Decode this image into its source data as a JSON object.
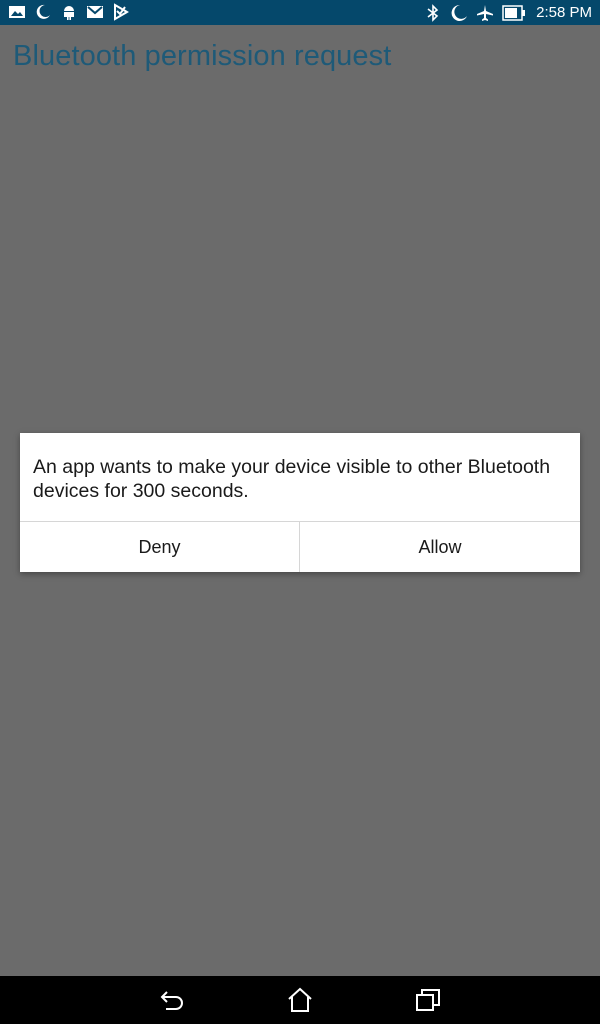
{
  "status_bar": {
    "time": "2:58 PM",
    "left_icons": [
      "image-icon",
      "moon-icon",
      "android-icon",
      "gmail-icon",
      "play-store-icon"
    ],
    "right_icons": [
      "bluetooth-icon",
      "do-not-disturb-icon",
      "airplane-mode-icon",
      "battery-icon"
    ]
  },
  "page": {
    "title": "Bluetooth permission request"
  },
  "dialog": {
    "message": "An app wants to make your device visible to other Bluetooth devices for 300 seconds.",
    "deny_label": "Deny",
    "allow_label": "Allow"
  },
  "nav_bar": {
    "icons": [
      "back-icon",
      "home-icon",
      "recent-apps-icon"
    ]
  },
  "colors": {
    "status_bar": "#05486b",
    "title": "#1e5a78",
    "scrim": "#6b6b6b",
    "dialog_bg": "#ffffff",
    "nav_bar": "#000000"
  }
}
